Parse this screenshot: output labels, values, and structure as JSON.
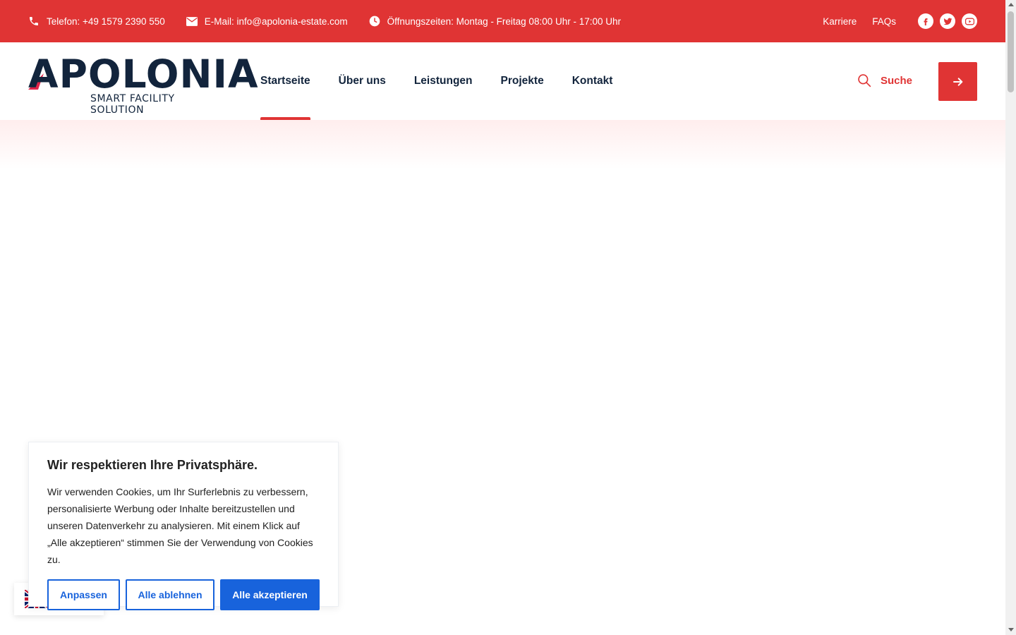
{
  "topbar": {
    "phone": "Telefon: +49 1579 2390 550",
    "email": "E-Mail: info@apolonia-estate.com",
    "hours": "Öffnungszeiten: Montag - Freitag 08:00 Uhr - 17:00 Uhr",
    "links": [
      "Karriere",
      "FAQs"
    ],
    "social_icons": [
      "facebook-icon",
      "twitter-icon",
      "youtube-icon"
    ],
    "bg_color": "#e03434"
  },
  "header": {
    "logo_word": "APOLONIA",
    "logo_tagline": "SMART FACILITY SOLUTION",
    "nav": [
      {
        "label": "Startseite",
        "active": true
      },
      {
        "label": "Über uns",
        "active": false
      },
      {
        "label": "Leistungen",
        "active": false
      },
      {
        "label": "Projekte",
        "active": false
      },
      {
        "label": "Kontakt",
        "active": false
      }
    ],
    "search_label": "Suche",
    "accent_color": "#e03434",
    "text_color": "#12243c"
  },
  "cookie": {
    "title": "Wir respektieren Ihre Privatsphäre.",
    "text": "Wir verwenden Cookies, um Ihr Surferlebnis zu verbessern, personalisierte Werbung oder Inhalte bereitzustellen und unseren Datenverkehr zu analysieren. Mit einem Klick auf „Alle akzeptieren“ stimmen Sie der Verwendung von Cookies zu.",
    "btn_customize": "Anpassen",
    "btn_reject": "Alle ablehnen",
    "btn_accept": "Alle akzeptieren",
    "button_color": "#1863dc"
  },
  "language": {
    "icon": "uk-flag-icon"
  }
}
